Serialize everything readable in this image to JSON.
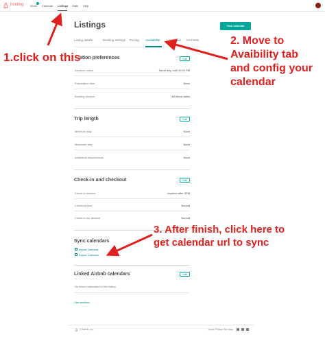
{
  "nav": {
    "brand": "hosting",
    "links": [
      "Inbox",
      "Calendar",
      "Listings",
      "Stats",
      "Help"
    ],
    "active": "Listings"
  },
  "page": {
    "title": "Listings",
    "view_calendar_button": "View calendar"
  },
  "tabs": [
    "Listing details",
    "Booking settings",
    "Pricing",
    "Availability",
    "Local laws",
    "Co-hosts"
  ],
  "sections": {
    "reservation": {
      "title": "ation preferences",
      "edit": "Edit",
      "rows": [
        {
          "label": "Advance notice",
          "value": "Same day, until 10:00 PM"
        },
        {
          "label": "Preparation time",
          "value": "None"
        },
        {
          "label": "Booking window",
          "value": "All future dates"
        }
      ]
    },
    "trip": {
      "title": "Trip length",
      "edit": "Edit",
      "rows": [
        {
          "label": "Minimum stay",
          "value": "None"
        },
        {
          "label": "Maximum stay",
          "value": "None"
        },
        {
          "label": "Additional requirements",
          "value": "None"
        }
      ]
    },
    "checkin": {
      "title": "Check-in and checkout",
      "edit": "Edit",
      "rows": [
        {
          "label": "Check-in window",
          "value": "Anytime after 3PM"
        },
        {
          "label": "Checkout time",
          "value": "Not set"
        },
        {
          "label": "Check-in not allowed",
          "value": "Not set"
        }
      ]
    },
    "sync": {
      "title": "Sync calendars",
      "import": "Import Calendar",
      "export": "Export Calendar"
    },
    "linked": {
      "title": "Linked Airbnb calendars",
      "edit": "Edit",
      "empty": "No linked calendars for this listing"
    },
    "feedback": "Give feedback"
  },
  "footer": {
    "copyright": "© Airbnb, Inc.",
    "links": "Terms  Privacy  Site Map"
  },
  "annotations": {
    "a1": "1.click on this",
    "a2_l1": "2. Move to",
    "a2_l2": "Avaibility tab",
    "a2_l3": "and config your",
    "a2_l4": "calendar",
    "a3_l1": "3. After finish, click here to",
    "a3_l2": "get calendar url to sync"
  },
  "colors": {
    "accent": "#00a699",
    "brand": "#ff5a5f",
    "annotation": "#e0201e"
  }
}
